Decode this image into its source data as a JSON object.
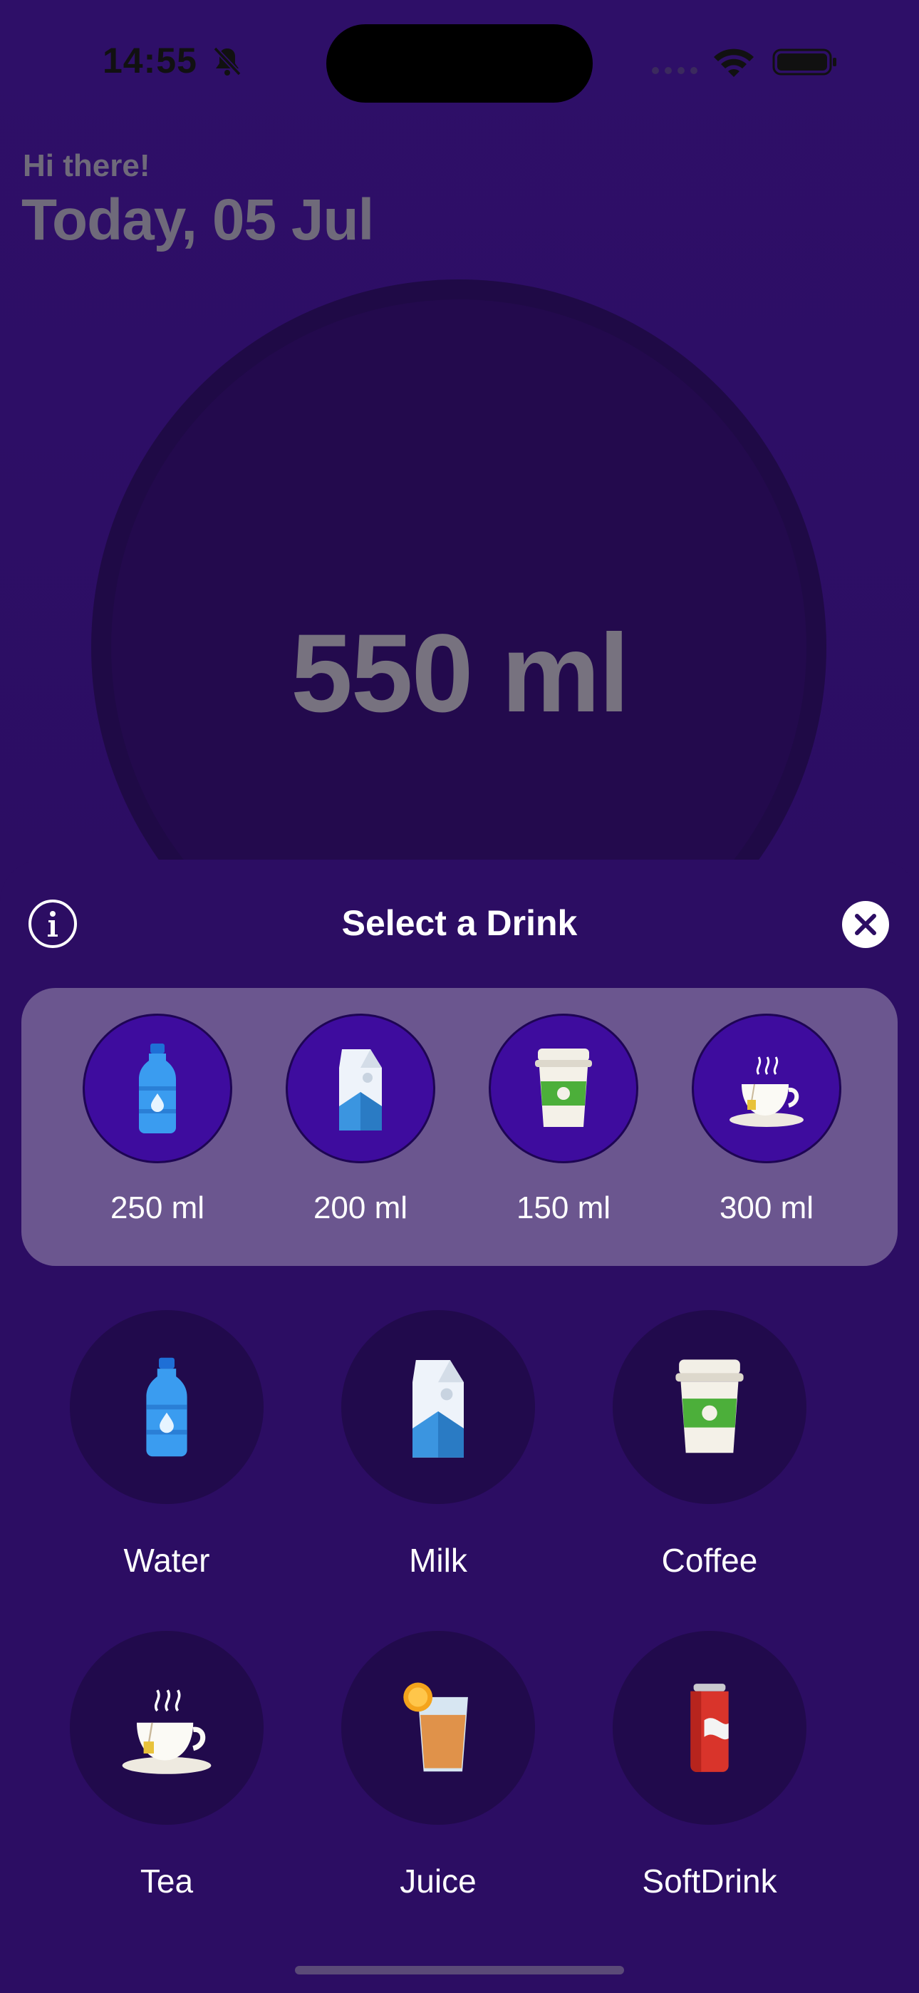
{
  "status_bar": {
    "time": "14:55"
  },
  "header": {
    "greeting": "Hi there!",
    "date": "Today, 05 Jul"
  },
  "progress": {
    "amount": "550 ml"
  },
  "sheet": {
    "title": "Select a Drink"
  },
  "quick_presets": [
    {
      "label": "250 ml",
      "icon": "water-bottle-icon"
    },
    {
      "label": "200 ml",
      "icon": "milk-carton-icon"
    },
    {
      "label": "150 ml",
      "icon": "coffee-cup-icon"
    },
    {
      "label": "300 ml",
      "icon": "tea-cup-icon"
    }
  ],
  "drinks": [
    {
      "label": "Water",
      "icon": "water-bottle-icon"
    },
    {
      "label": "Milk",
      "icon": "milk-carton-icon"
    },
    {
      "label": "Coffee",
      "icon": "coffee-cup-icon"
    },
    {
      "label": "Tea",
      "icon": "tea-cup-icon"
    },
    {
      "label": "Juice",
      "icon": "juice-glass-icon"
    },
    {
      "label": "SoftDrink",
      "icon": "soda-can-icon"
    }
  ],
  "colors": {
    "background": "#2c0d63",
    "panel": "#6b568f",
    "preset_circle": "#3e0c9e",
    "drink_circle": "#210a4c",
    "water": "#2a6e9a"
  }
}
